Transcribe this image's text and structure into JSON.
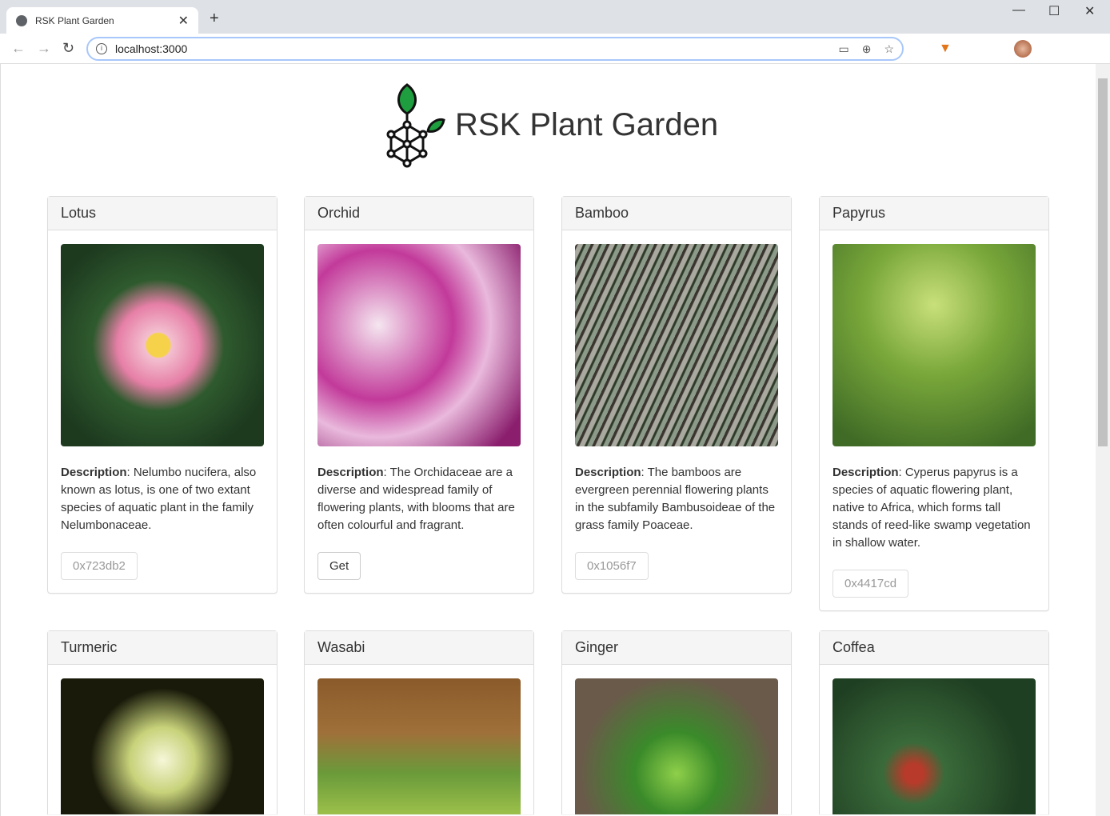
{
  "browser": {
    "tab_title": "RSK Plant Garden",
    "url": "localhost:3000"
  },
  "header": {
    "title": "RSK Plant Garden"
  },
  "desc_label": "Description",
  "plants": [
    {
      "name": "Lotus",
      "description": ": Nelumbo nucifera, also known as lotus, is one of two extant species of aquatic plant in the family Nelumbonaceae.",
      "button": "0x723db2",
      "owned": true
    },
    {
      "name": "Orchid",
      "description": ": The Orchidaceae are a diverse and widespread family of flowering plants, with blooms that are often colourful and fragrant.",
      "button": "Get",
      "owned": false
    },
    {
      "name": "Bamboo",
      "description": ": The bamboos are evergreen perennial flowering plants in the subfamily Bambusoideae of the grass family Poaceae.",
      "button": "0x1056f7",
      "owned": true
    },
    {
      "name": "Papyrus",
      "description": ": Cyperus papyrus is a species of aquatic flowering plant, native to Africa, which forms tall stands of reed-like swamp vegetation in shallow water.",
      "button": "0x4417cd",
      "owned": true
    },
    {
      "name": "Turmeric"
    },
    {
      "name": "Wasabi"
    },
    {
      "name": "Ginger"
    },
    {
      "name": "Coffea"
    }
  ]
}
